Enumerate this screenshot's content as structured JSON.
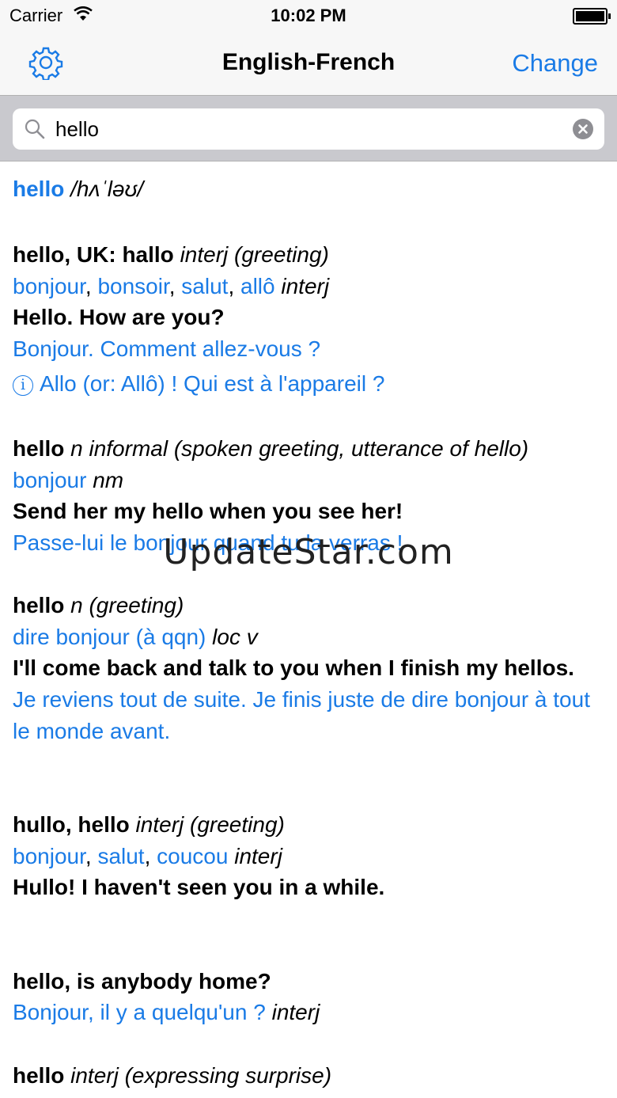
{
  "status_bar": {
    "carrier": "Carrier",
    "time": "10:02 PM"
  },
  "nav": {
    "title": "English-French",
    "change_label": "Change",
    "settings_icon": "gear-icon"
  },
  "search": {
    "value": "hello",
    "icon": "search-icon",
    "clear_icon": "clear-icon"
  },
  "headword": {
    "word": "hello",
    "pronunciation": "/hʌˈləʊ/"
  },
  "entries": [
    {
      "term": "hello, UK: hallo",
      "grammar": "interj (greeting)",
      "translations": [
        "bonjour",
        "bonsoir",
        "salut",
        "allô"
      ],
      "translation_pos": "interj",
      "example": "Hello. How are you?",
      "example_translation": "Bonjour. Comment allez-vous ?",
      "note": "Allo (or: Allô) ! Qui est à l'appareil ?"
    },
    {
      "term": "hello",
      "grammar": "n informal (spoken greeting, utterance of hello)",
      "translations": [
        "bonjour"
      ],
      "translation_pos": "nm",
      "example": "Send her my hello when you see her!",
      "example_translation": "Passe-lui le bonjour quand tu la verras !"
    },
    {
      "term": "hello",
      "grammar": "n (greeting)",
      "translations": [
        "dire bonjour (à qqn)"
      ],
      "translation_pos": "loc v",
      "example": "I'll come back and talk to you when I finish my hellos.",
      "example_translation": "Je reviens tout de suite. Je finis juste de dire bonjour à tout le monde avant."
    },
    {
      "term": "hullo, hello",
      "grammar": "interj (greeting)",
      "translations": [
        "bonjour",
        "salut",
        "coucou"
      ],
      "translation_pos": "interj",
      "example": "Hullo! I haven't seen you in a while."
    },
    {
      "term": "hello, is anybody home?",
      "translations": [
        "Bonjour, il y a quelqu'un ?"
      ],
      "translation_pos": "interj"
    },
    {
      "term": "hello",
      "grammar": "interj (expressing surprise)"
    }
  ],
  "watermark": "UpdateStar.com",
  "colors": {
    "link_blue": "#1a7be6",
    "bar_bg": "#f7f7f7",
    "search_bg": "#c9c9ce"
  }
}
